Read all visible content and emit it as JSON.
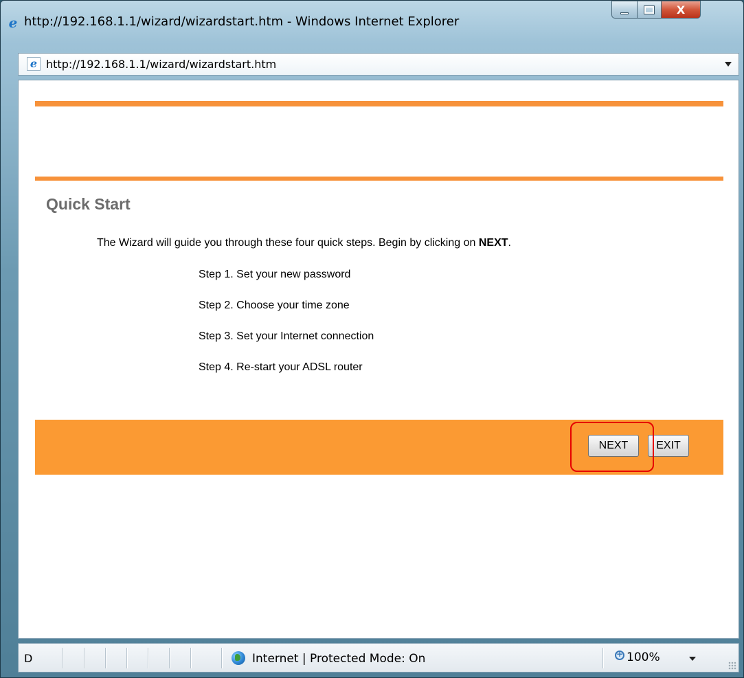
{
  "window": {
    "title": "http://192.168.1.1/wizard/wizardstart.htm - Windows Internet Explorer",
    "controls": {
      "minimize": "",
      "maximize": "",
      "close": "X"
    }
  },
  "addressbar": {
    "url": "http://192.168.1.1/wizard/wizardstart.htm"
  },
  "page": {
    "heading": "Quick Start",
    "intro_prefix": "The Wizard will guide you through these four quick steps. Begin by clicking on ",
    "intro_bold": "NEXT",
    "intro_suffix": ".",
    "steps": [
      "Step 1. Set your new password",
      "Step 2. Choose your time zone",
      "Step 3. Set your Internet connection",
      "Step 4. Re-start your ADSL router"
    ],
    "buttons": {
      "next": "NEXT",
      "exit": "EXIT"
    }
  },
  "statusbar": {
    "left_text": "D",
    "zone": "Internet | Protected Mode: On",
    "zoom": "100%"
  },
  "colors": {
    "accent_orange": "#f7923a",
    "highlight_red": "#e60000"
  },
  "icons": [
    "ie-logo-icon",
    "page-icon",
    "globe-icon",
    "zoom-icon",
    "dropdown-arrow-icon"
  ]
}
